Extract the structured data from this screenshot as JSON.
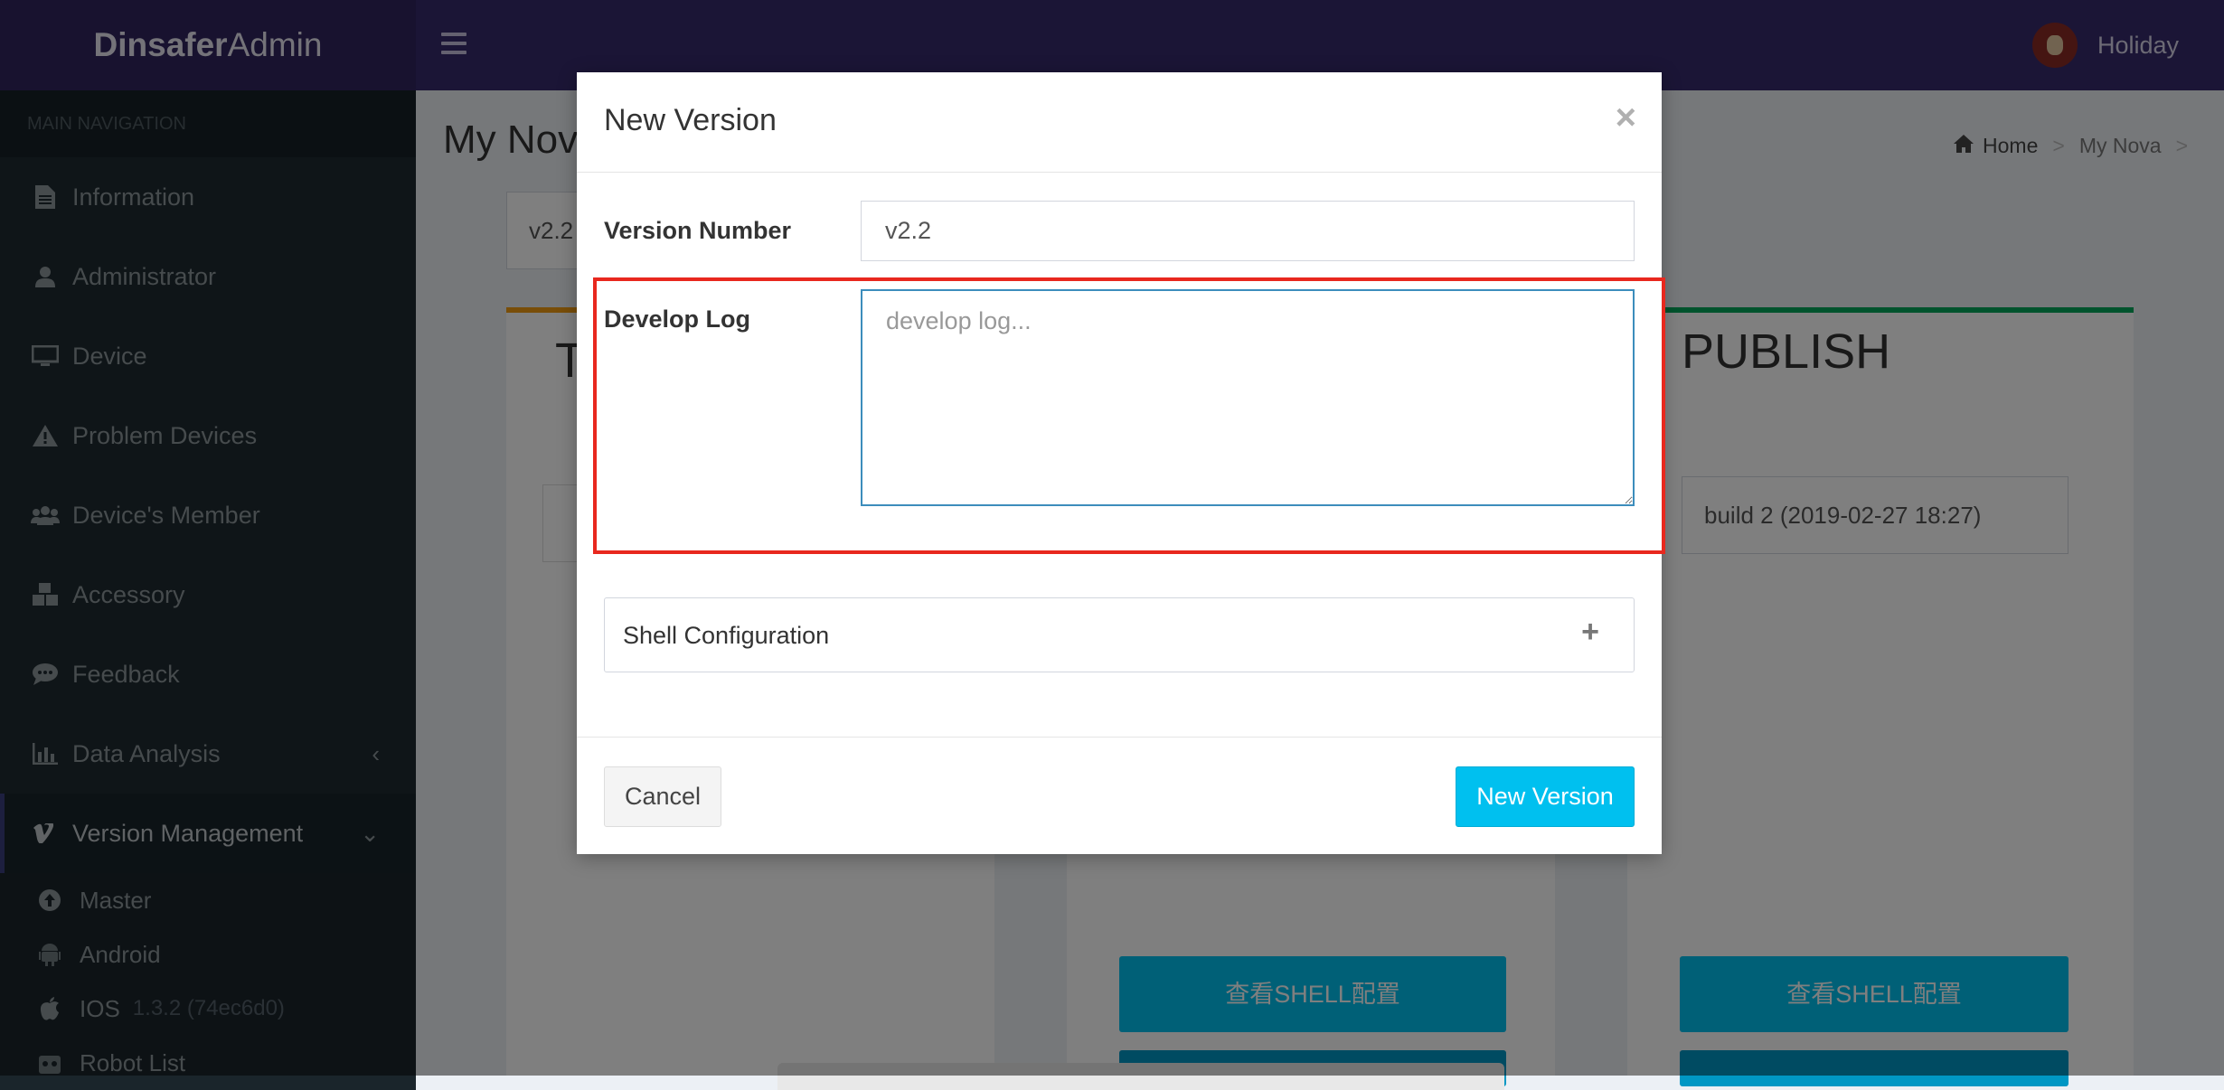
{
  "app": {
    "logo_bold": "Dinsafer",
    "logo_light": "Admin",
    "user_name": "Holiday"
  },
  "sidebar": {
    "header": "MAIN NAVIGATION",
    "items": [
      {
        "label": "Information",
        "icon": "file-text-icon"
      },
      {
        "label": "Administrator",
        "icon": "user-icon"
      },
      {
        "label": "Device",
        "icon": "monitor-icon"
      },
      {
        "label": "Problem Devices",
        "icon": "warning-icon"
      },
      {
        "label": "Device's Member",
        "icon": "users-icon"
      },
      {
        "label": "Accessory",
        "icon": "cubes-icon"
      },
      {
        "label": "Feedback",
        "icon": "comment-icon"
      },
      {
        "label": "Data Analysis",
        "icon": "bar-chart-icon"
      },
      {
        "label": "Version Management",
        "icon": "vimeo-icon"
      }
    ],
    "subitems": [
      {
        "label": "Master",
        "icon": "arrow-circle-up-icon",
        "extra": ""
      },
      {
        "label": "Android",
        "icon": "android-icon",
        "extra": ""
      },
      {
        "label": "IOS",
        "icon": "apple-icon",
        "extra": "1.3.2 (74ec6d0)"
      },
      {
        "label": "Robot List",
        "icon": "robot-icon",
        "extra": ""
      }
    ]
  },
  "content": {
    "page_title": "My Nova",
    "breadcrumb": {
      "home": "Home",
      "current": "My Nova"
    },
    "version_select": "v2.2",
    "col1_title": "T",
    "col3_title": "PUBLISH",
    "build_value": "build 2 (2019-02-27 18:27)",
    "shell_button": "查看SHELL配置"
  },
  "modal": {
    "title": "New Version",
    "close": "×",
    "version_label": "Version Number",
    "version_value": "v2.2",
    "devlog_label": "Develop Log",
    "devlog_placeholder": "develop log...",
    "shell_panel_title": "Shell Configuration",
    "shell_panel_toggle": "+",
    "cancel_label": "Cancel",
    "submit_label": "New Version"
  },
  "colors": {
    "header": "#372b6d",
    "sidebar": "#1e2a30",
    "primary_button": "#00c0ef",
    "highlight": "#e8281e"
  }
}
